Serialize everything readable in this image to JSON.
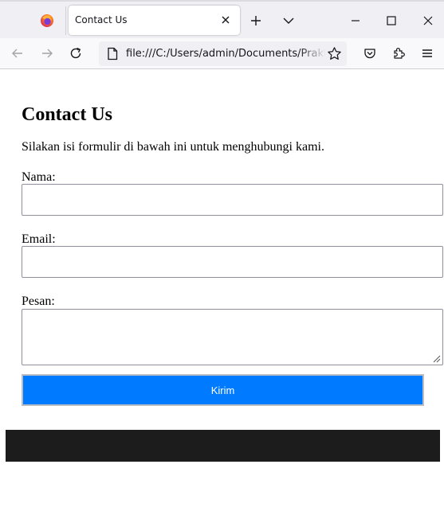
{
  "browser": {
    "tab_title": "Contact Us",
    "url": "file:///C:/Users/admin/Documents/Praktikum",
    "icons": {
      "logo": "firefox-logo",
      "tab_close": "close-icon",
      "new_tab": "plus-icon",
      "tab_list": "chevron-down-icon",
      "minimize": "minimize-icon",
      "maximize": "maximize-icon",
      "window_close": "close-icon",
      "back": "arrow-left-icon",
      "forward": "arrow-right-icon",
      "reload": "reload-icon",
      "page": "page-icon",
      "bookmark": "star-icon",
      "pocket": "pocket-icon",
      "extensions": "puzzle-icon",
      "menu": "hamburger-icon"
    }
  },
  "page": {
    "heading": "Contact Us",
    "intro": "Silakan isi formulir di bawah ini untuk menghubungi kami.",
    "form": {
      "name_label": "Nama:",
      "name_value": "",
      "email_label": "Email:",
      "email_value": "",
      "message_label": "Pesan:",
      "message_value": "",
      "submit_label": "Kirim"
    }
  },
  "colors": {
    "submit_button": "#007bff",
    "footer": "#1c1c1c"
  }
}
